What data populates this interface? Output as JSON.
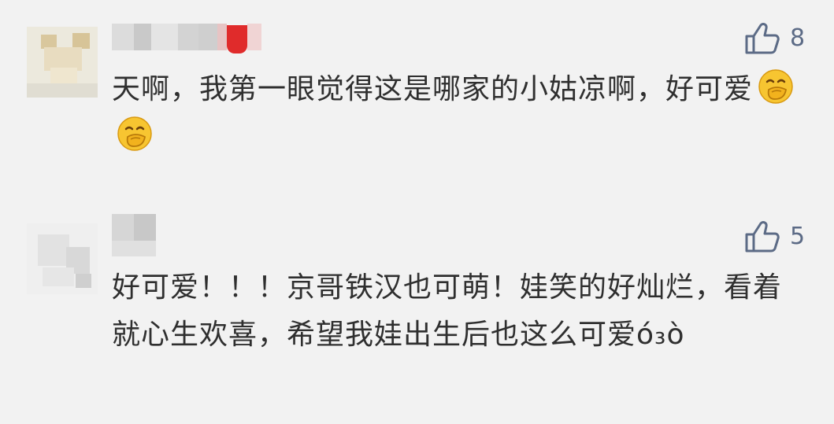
{
  "comments": [
    {
      "likes": "8",
      "text": "天啊，我第一眼觉得这是哪家的小姑凉啊，好可爱",
      "emojis": [
        "face-with-hand-over-mouth-emoji",
        "face-with-hand-over-mouth-emoji"
      ],
      "avatar_style": "cartoon-cat-blurred",
      "name_style": "pixelated-with-red-patch"
    },
    {
      "likes": "5",
      "text": "好可爱！！！京哥铁汉也可萌！娃笑的好灿烂，看着就心生欢喜，希望我娃出生后也这么可爱ό₃ὸ",
      "emojis": [],
      "avatar_style": "blurred-gray",
      "name_style": "pixelated-gray"
    }
  ],
  "colors": {
    "background": "#f2f2f2",
    "like_icon": "#5c6b86",
    "text": "#2f2f2f"
  },
  "icons": {
    "like": "thumbs-up-icon"
  }
}
